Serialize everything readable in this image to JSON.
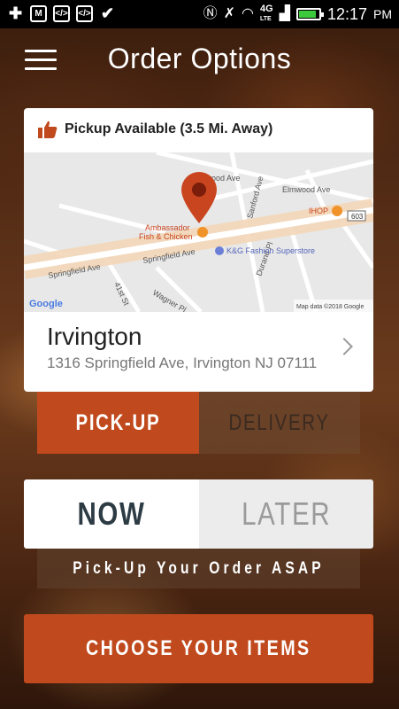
{
  "status_bar": {
    "network": "4G",
    "network_sub": "LTE",
    "time": "12:17",
    "ampm": "PM",
    "battery_level": 0.85,
    "battery_color": "#3cc93c"
  },
  "header": {
    "title": "Order Options"
  },
  "store": {
    "pickup_status": "Pickup Available (3.5 Mi. Away)",
    "name": "Irvington",
    "address": "1316 Springfield Ave, Irvington NJ 07111"
  },
  "map": {
    "labels": {
      "elmwood_1": "Elmwood Ave",
      "elmwood_2": "Elmwood Ave",
      "sanford": "Sanford Ave",
      "ihop": "IHOP",
      "route": "603",
      "ambassador_1": "Ambassador",
      "ambassador_2": "Fish & Chicken",
      "springfield_1": "Springfield Ave",
      "springfield_2": "Springfield Ave",
      "kg": "K&G Fashion Superstore",
      "street_41": "41st St",
      "durand": "Durand Pl",
      "wagner": "Wagner Pl",
      "google": "Google",
      "attribution": "Map data ©2018 Google"
    },
    "pin_color": "#c9451f"
  },
  "order_type": {
    "pickup_label": "PICK-UP",
    "delivery_label": "DELIVERY",
    "selected": "PICK-UP"
  },
  "timing": {
    "now_label": "NOW",
    "later_label": "LATER",
    "selected": "NOW",
    "note": "Pick-Up Your Order ASAP"
  },
  "cta": {
    "label": "CHOOSE YOUR ITEMS"
  },
  "colors": {
    "accent": "#c04a1e",
    "dark_text": "#2d3b44"
  }
}
